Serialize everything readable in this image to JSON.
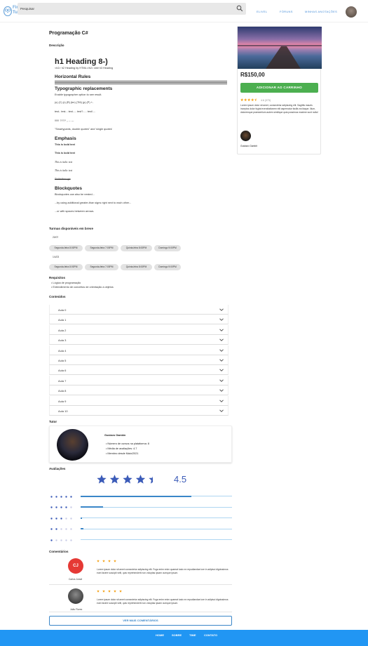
{
  "nav": {
    "logo_line1": "Find",
    "logo_line2": "a",
    "logo_line3": "Tutor",
    "search_placeholder": "Pesquisar",
    "links": [
      "ELIVEL",
      "FÓRUNS",
      "MINHAS ANOTAÇÕES"
    ]
  },
  "course": {
    "title": "Programação C#",
    "description_label": "Descrição",
    "h1": "h1 Heading 8-)",
    "heading_line": "<h2> h2 Heading by HTML</h2> ### h3 Heading",
    "horizontal_rules": "Horizontal Rules",
    "typo_heading": "Typographic replacements",
    "typo_text": "Enable typographer option to see result.",
    "typo_symbols": "(c) (C) (r) (R) (tm) (TM) (p) (P) +-",
    "typo_dots": "test.. test... test..... test?..... test!....",
    "typo_excl": "!!!!!! ???? ,, -- ---",
    "typo_quotes": "\"Smartypants, double quotes\" and 'single quotes'",
    "emphasis_heading": "Emphasis",
    "bold1": "This is bold text",
    "bold2": "This is bold text",
    "italic1": "This is italic text",
    "italic2": "This is italic text",
    "strike": "Strikethrough",
    "blockquotes_heading": "Blockquotes",
    "bq1": "Blockquotes can also be nested...",
    "bq2": "...by using additional greater-than signs right next to each other...",
    "bq3": "...or with spaces between arrows."
  },
  "sidebar_card": {
    "price": "R$150,00",
    "cart_button": "ADICIONAR AO CARRINHO",
    "rating_text": "4.6 (373)",
    "rating_value": 4.6,
    "lorem": "Lorem ipsum dolor sit amet, consectetur adipiscing elit. Sagittis mauris inceptos dolor fugiat exercitationem elit aspernatur facilis ea itaque. Illum, doloremque praesentium autem similique quia possimus maxime sunt nulla!",
    "author": "Gustavo Gambit"
  },
  "turmas": {
    "label": "Turmas disponíveis em breve",
    "groups": [
      {
        "date": "20/07",
        "chips": [
          "Segunda-feira 8:00PM",
          "Segunda-feira 7:00PM",
          "Quinta-feira 8:00PM",
          "Domingo 9:00PM"
        ]
      },
      {
        "date": "1/4/23",
        "chips": [
          "Segunda-feira 8:00PM",
          "Segunda-feira 7:00PM",
          "Quinta-feira 8:00PM",
          "Domingo 9:00PM"
        ]
      }
    ]
  },
  "requisitos": {
    "label": "Requisitos",
    "items": [
      "Lógica de programação",
      "Entendimento de conceitos de orientação a objetos"
    ]
  },
  "conteudos": {
    "label": "Conteúdos",
    "items": [
      "Aula 0",
      "Aula 1",
      "Aula 2",
      "Aula 3",
      "Aula 4",
      "Aula 5",
      "Aula 6",
      "Aula 7",
      "Aula 8",
      "Aula 9",
      "Aula 10"
    ]
  },
  "tutor": {
    "label": "Tutor",
    "name": "Gustavo Gambin",
    "facts": [
      "Número de cursos na plataforma: 8",
      "Média de avaliações: 4.7",
      "Membro desde Maio/2021"
    ]
  },
  "avaliacoes": {
    "label": "Avaliações",
    "score": "4.5",
    "score_value": 4.5,
    "distribution": [
      0.73,
      0.15,
      0.01,
      0.02,
      0.0
    ]
  },
  "comentarios": {
    "label": "Comentários",
    "items": [
      {
        "initials": "CJ",
        "name": "Carlos Jorsel",
        "stars": 4,
        "text": "Lorem ipsum dolor sit amet consectetur adipiscing elit. Fuga enim enim quaerat iusto ex repudiandae iure in adipisci dignissimos eum facere suscipit velit, quis reprehenderit non voluptas ipsam cumque ipsum."
      },
      {
        "initials": "",
        "name": "João Flores",
        "stars": 5,
        "text": "Lorem ipsum dolor sit amet consectetur adipiscing elit. Fuga enim enim quaerat iusto ex repudiandae iure in adipisci dignissimos eum facere suscipit velit, quis reprehenderit non voluptas ipsam cumque ipsum."
      }
    ],
    "see_more": "VER MAIS COMENTÁRIOS"
  },
  "footer": {
    "links": [
      "HOME",
      "SOBRE",
      "TIME",
      "CONTATO"
    ]
  },
  "colors": {
    "primary": "#2196f3",
    "accent_green": "#4caf50",
    "star_blue": "#3b5bb8",
    "star_orange": "#f5a623",
    "avatar_red": "#e53935"
  }
}
